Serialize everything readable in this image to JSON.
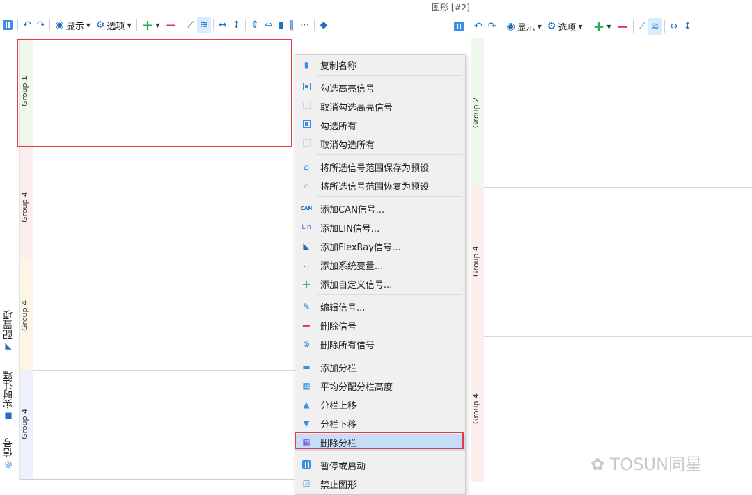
{
  "window_title": "图形 [#2]",
  "toolbar": {
    "show_label": "显示",
    "options_label": "选项"
  },
  "left_panel": {
    "groups": [
      "Group 1",
      "Group 4",
      "Group 4",
      "Group 4"
    ]
  },
  "right_panel": {
    "groups": [
      "Group 2",
      "Group 4",
      "Group 4"
    ]
  },
  "vertical_tabs": {
    "config": "配置项",
    "annotation": "实时注释",
    "signal": "信号"
  },
  "context_menu": {
    "items": [
      {
        "label": "复制名称",
        "icon": "copy-icon"
      },
      {
        "label": "勾选高亮信号",
        "icon": "checkbox-checked-icon"
      },
      {
        "label": "取消勾选高亮信号",
        "icon": "checkbox-empty-icon"
      },
      {
        "label": "勾选所有",
        "icon": "checkbox-checked-icon"
      },
      {
        "label": "取消勾选所有",
        "icon": "checkbox-empty-icon"
      },
      {
        "label": "将所选信号范围保存为预设",
        "icon": "home-filled-icon"
      },
      {
        "label": "将所选信号范围恢复为预设",
        "icon": "home-outline-icon"
      },
      {
        "label": "添加CAN信号...",
        "icon": "can-icon"
      },
      {
        "label": "添加LIN信号...",
        "icon": "lin-icon"
      },
      {
        "label": "添加FlexRay信号...",
        "icon": "flexray-icon"
      },
      {
        "label": "添加系统变量...",
        "icon": "system-var-icon"
      },
      {
        "label": "添加自定义信号...",
        "icon": "plus-icon"
      },
      {
        "label": "编辑信号...",
        "icon": "pencil-icon"
      },
      {
        "label": "删除信号",
        "icon": "minus-icon"
      },
      {
        "label": "删除所有信号",
        "icon": "close-circle-icon"
      },
      {
        "label": "添加分栏",
        "icon": "add-column-icon"
      },
      {
        "label": "平均分配分栏高度",
        "icon": "equal-height-icon"
      },
      {
        "label": "分栏上移",
        "icon": "triangle-up-icon"
      },
      {
        "label": "分栏下移",
        "icon": "triangle-down-icon"
      },
      {
        "label": "删除分栏",
        "icon": "delete-column-icon"
      },
      {
        "label": "暂停或启动",
        "icon": "pause-icon"
      },
      {
        "label": "禁止图形",
        "icon": "check-square-icon"
      }
    ]
  },
  "watermark": "TOSUN同星",
  "colors": {
    "accent": "#3a8ee6",
    "highlight_box": "#e23b4b",
    "add_green": "#21b05a",
    "remove_red": "#e0353d"
  }
}
